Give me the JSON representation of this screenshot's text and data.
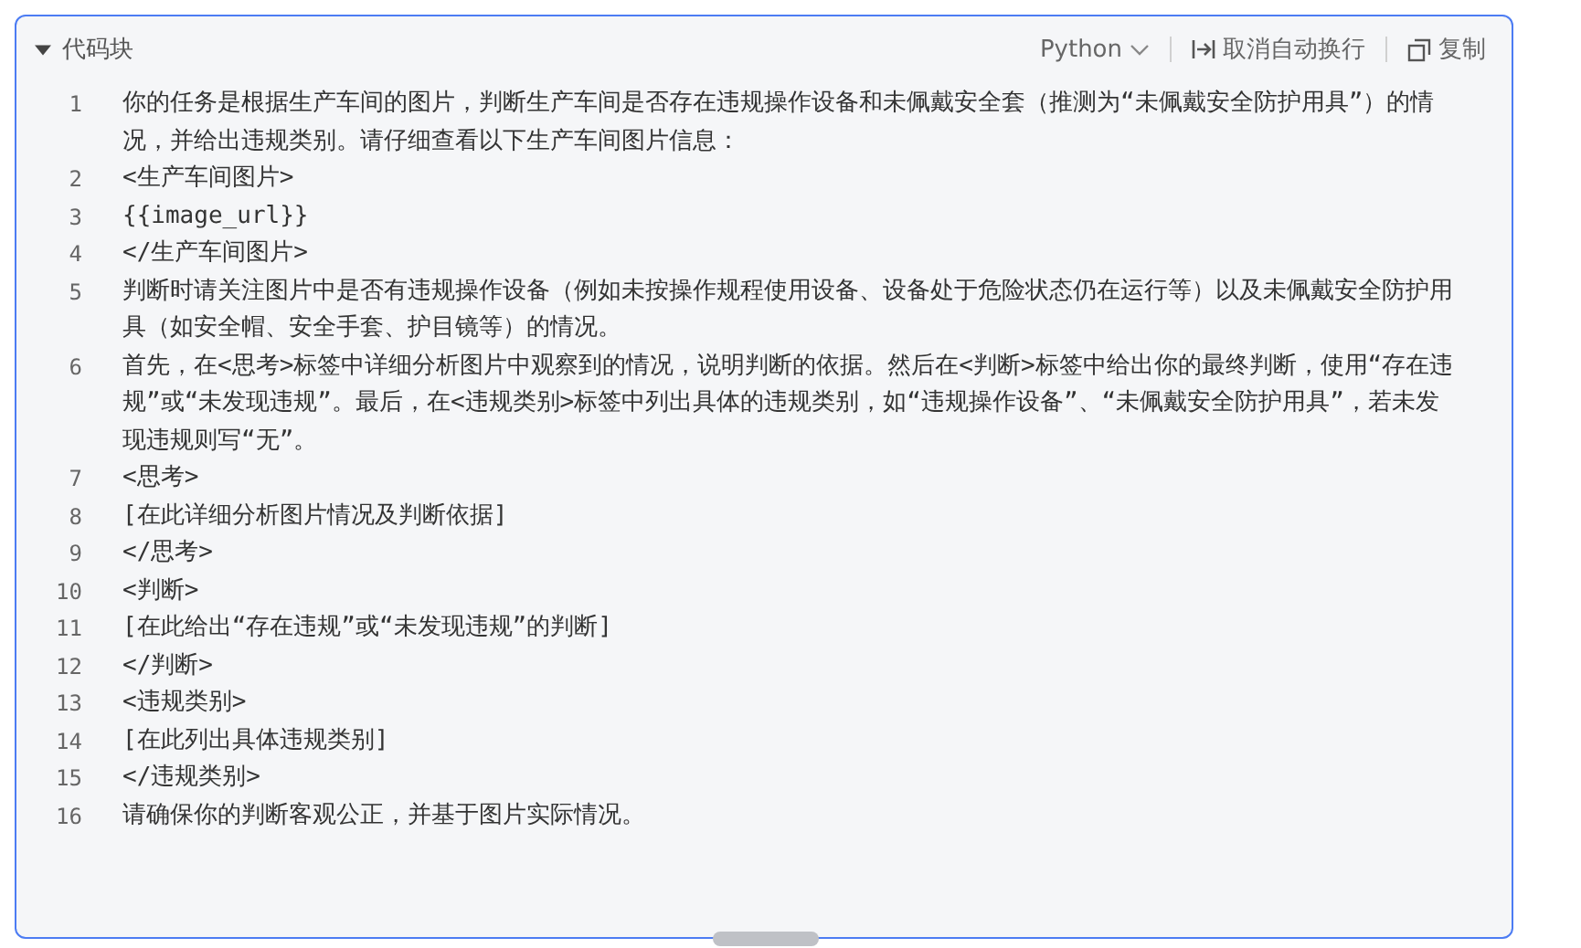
{
  "header": {
    "title": "代码块",
    "expanded": true,
    "language": "Python",
    "wrap_button": "取消自动换行",
    "copy_button": "复制"
  },
  "lines": [
    {
      "number": "1",
      "text": "你的任务是根据生产车间的图片，判断生产车间是否存在违规操作设备和未佩戴安全套（推测为“未佩戴安全防护用具”）的情况，并给出违规类别。请仔细查看以下生产车间图片信息："
    },
    {
      "number": "2",
      "text": "<生产车间图片>"
    },
    {
      "number": "3",
      "text": "{{image_url}}"
    },
    {
      "number": "4",
      "text": "</生产车间图片>"
    },
    {
      "number": "5",
      "text": "判断时请关注图片中是否有违规操作设备（例如未按操作规程使用设备、设备处于危险状态仍在运行等）以及未佩戴安全防护用具（如安全帽、安全手套、护目镜等）的情况。"
    },
    {
      "number": "6",
      "text": "首先，在<思考>标签中详细分析图片中观察到的情况，说明判断的依据。然后在<判断>标签中给出你的最终判断，使用“存在违规”或“未发现违规”。最后，在<违规类别>标签中列出具体的违规类别，如“违规操作设备”、“未佩戴安全防护用具”，若未发现违规则写“无”。"
    },
    {
      "number": "7",
      "text": "<思考>"
    },
    {
      "number": "8",
      "text": "[在此详细分析图片情况及判断依据]"
    },
    {
      "number": "9",
      "text": "</思考>"
    },
    {
      "number": "10",
      "text": "<判断>"
    },
    {
      "number": "11",
      "text": "[在此给出“存在违规”或“未发现违规”的判断]"
    },
    {
      "number": "12",
      "text": "</判断>"
    },
    {
      "number": "13",
      "text": "<违规类别>"
    },
    {
      "number": "14",
      "text": "[在此列出具体违规类别]"
    },
    {
      "number": "15",
      "text": "</违规类别>"
    },
    {
      "number": "16",
      "text": "请确保你的判断客观公正，并基于图片实际情况。"
    }
  ]
}
